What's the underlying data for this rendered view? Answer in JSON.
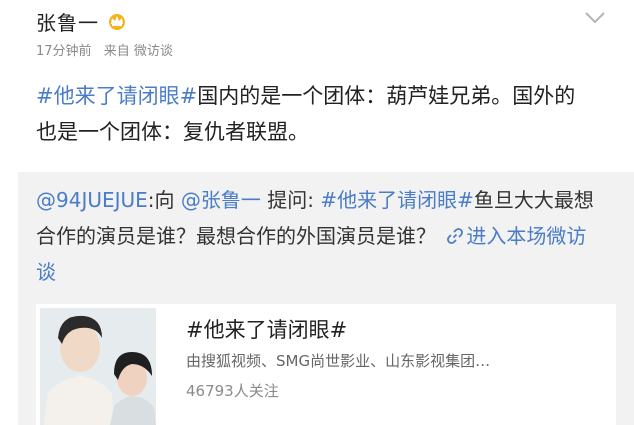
{
  "post": {
    "author": "张鲁一",
    "time": "17分钟前",
    "source": "来自 微访谈",
    "topic": "#他来了请闭眼#",
    "text": "国内的是一个团体：葫芦娃兄弟。国外的也是一个团体：复仇者联盟。"
  },
  "repost": {
    "asker": "@94JUEJUE",
    "to_word": ":向",
    "mention": "@张鲁一",
    "ask_word": "提问:",
    "topic": "#他来了请闭眼#",
    "question": "鱼旦大大最想合作的演员是谁？最想合作的外国演员是谁？",
    "link_text": "进入本场微访谈"
  },
  "card": {
    "title": "#他来了请闭眼#",
    "description": "由搜狐视频、SMG尚世影业、山东影视集团…",
    "followers": "46793人关注"
  },
  "icons": [
    "crown-icon",
    "chevron-down-icon",
    "link-icon"
  ],
  "colors": {
    "link": "#4a7cc8",
    "card_bg": "#f2f2f2",
    "meta": "#8a8a8a"
  }
}
